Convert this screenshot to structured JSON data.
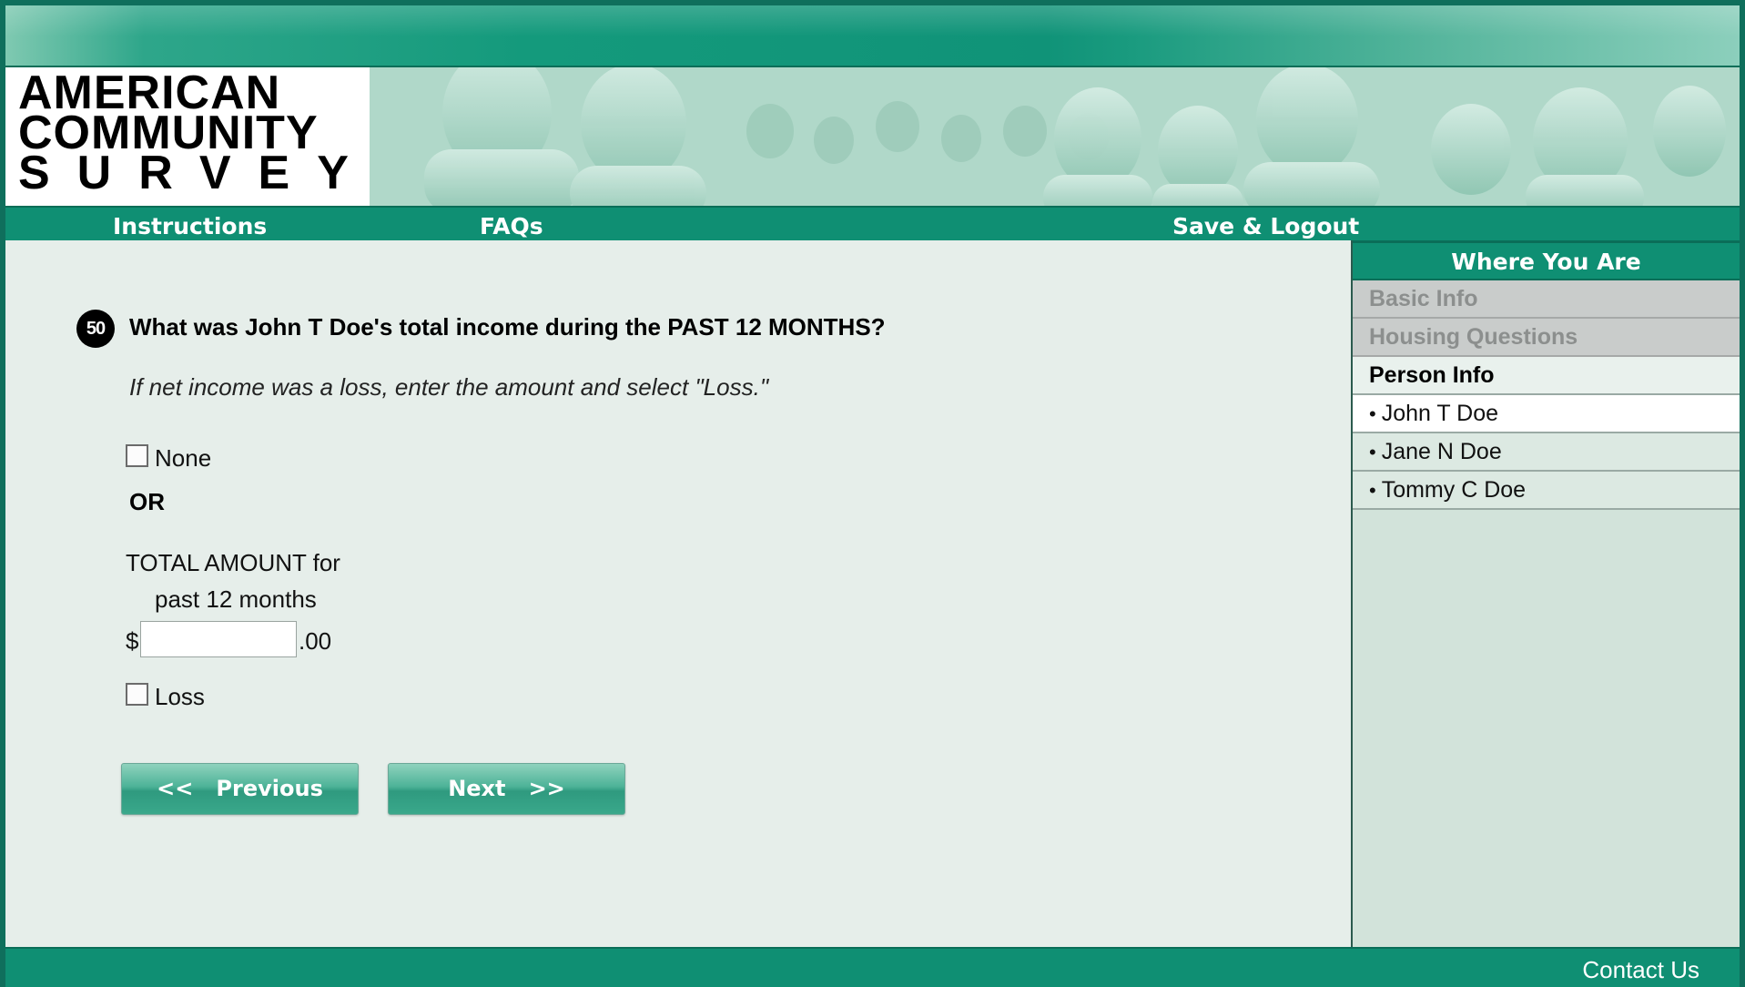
{
  "logo": {
    "line1": "AMERICAN",
    "line2": "COMMUNITY",
    "line3": "SURVEY"
  },
  "nav": {
    "instructions": "Instructions",
    "faqs": "FAQs",
    "save_logout": "Save & Logout"
  },
  "sidebar": {
    "title": "Where You Are",
    "items": [
      {
        "label": "Basic Info",
        "state": "disabled"
      },
      {
        "label": "Housing Questions",
        "state": "disabled"
      }
    ],
    "section_label": "Person Info",
    "people": [
      {
        "label": "John T Doe",
        "active": true
      },
      {
        "label": "Jane N Doe",
        "active": false
      },
      {
        "label": "Tommy C Doe",
        "active": false
      }
    ]
  },
  "question": {
    "number": "50",
    "text": "What was John T Doe's total income during the PAST 12 MONTHS?",
    "hint": "If net income was a loss, enter the amount and select \"Loss.\"",
    "none_label": "None",
    "or_label": "OR",
    "amount_label_line1": "TOTAL AMOUNT for",
    "amount_label_line2": "past 12 months",
    "currency_symbol": "$",
    "amount_value": "",
    "cents_suffix": ".00",
    "loss_label": "Loss"
  },
  "buttons": {
    "previous": "<<   Previous",
    "next": "Next   >>"
  },
  "footer": {
    "contact": "Contact Us"
  },
  "colors": {
    "brand_green": "#0f8f73",
    "dark_green": "#0a6e58",
    "content_bg": "#e6eeea",
    "sidebar_bg": "#d2e3da"
  }
}
